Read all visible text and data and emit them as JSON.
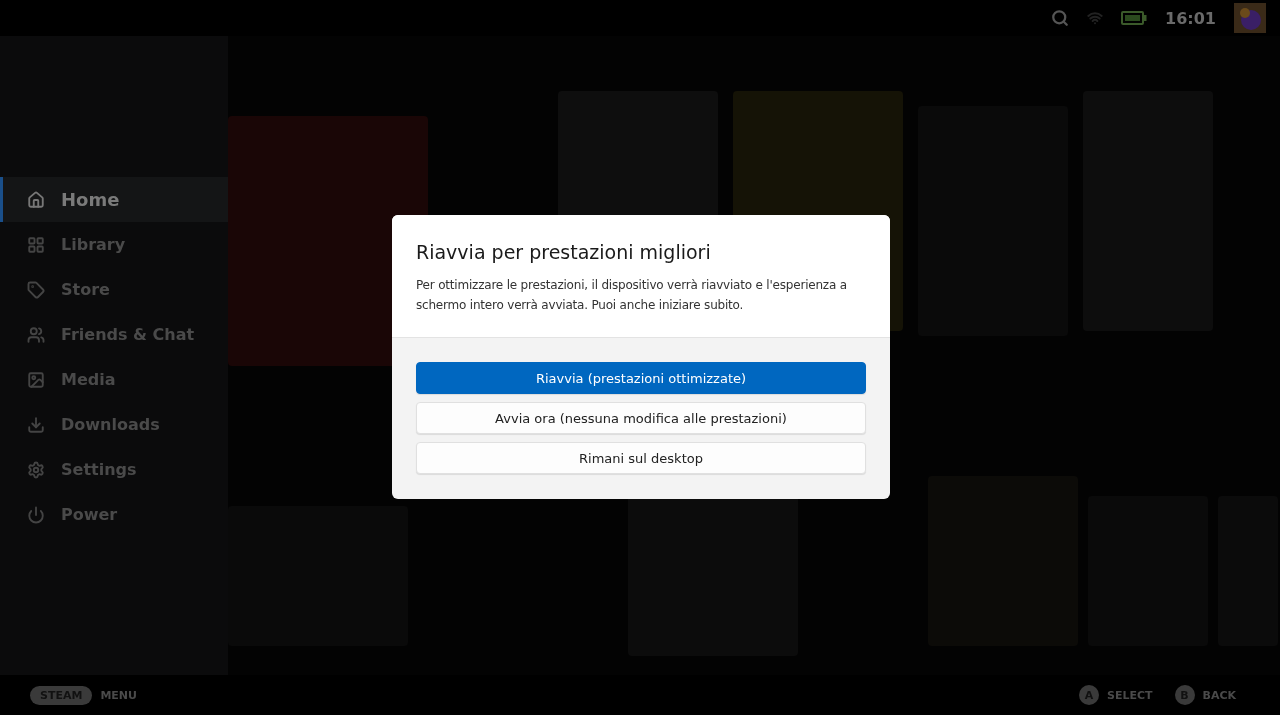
{
  "status_bar": {
    "time": "16:01"
  },
  "sidebar": {
    "items": [
      {
        "label": "Home",
        "selected": true
      },
      {
        "label": "Library",
        "selected": false
      },
      {
        "label": "Store",
        "selected": false
      },
      {
        "label": "Friends & Chat",
        "selected": false
      },
      {
        "label": "Media",
        "selected": false
      },
      {
        "label": "Downloads",
        "selected": false
      },
      {
        "label": "Settings",
        "selected": false
      },
      {
        "label": "Power",
        "selected": false
      }
    ]
  },
  "dialog": {
    "title": "Riavvia per prestazioni migliori",
    "message": "Per ottimizzare le prestazioni, il dispositivo verrà riavviato e l'esperienza a schermo intero verrà avviata. Puoi anche iniziare subito.",
    "buttons": [
      {
        "label": "Riavvia (prestazioni ottimizzate)",
        "selected": true
      },
      {
        "label": "Avvia ora (nessuna modifica alle prestazioni)",
        "selected": false
      },
      {
        "label": "Rimani sul desktop",
        "selected": false
      }
    ]
  },
  "footer": {
    "left": [
      {
        "key": "STEAM",
        "label": "MENU"
      }
    ],
    "right": [
      {
        "key": "A",
        "label": "SELECT"
      },
      {
        "key": "B",
        "label": "BACK"
      }
    ]
  }
}
